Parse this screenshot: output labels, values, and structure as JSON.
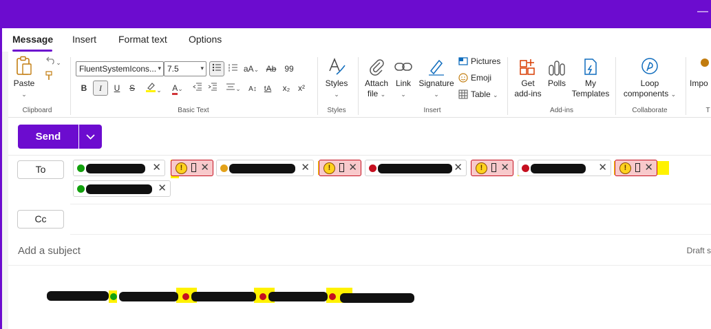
{
  "window": {
    "minimize_glyph": "—"
  },
  "tabs": [
    {
      "label": "Message",
      "active": true
    },
    {
      "label": "Insert",
      "active": false
    },
    {
      "label": "Format text",
      "active": false
    },
    {
      "label": "Options",
      "active": false
    }
  ],
  "ribbon": {
    "clipboard": {
      "paste_label": "Paste",
      "group_label": "Clipboard"
    },
    "basic_text": {
      "font_name": "FluentSystemIcons...",
      "font_size": "7.5",
      "bold": "B",
      "italic": "I",
      "underline": "U",
      "strike": "S",
      "subscript": "x₂",
      "superscript": "x²",
      "group_label": "Basic Text"
    },
    "styles": {
      "label": "Styles",
      "group_label": "Styles"
    },
    "insert": {
      "attach_label": "Attach",
      "attach_label2": "file",
      "link_label": "Link",
      "signature_label": "Signature",
      "pictures_label": "Pictures",
      "emoji_label": "Emoji",
      "table_label": "Table",
      "group_label": "Insert"
    },
    "addins": {
      "get_label": "Get",
      "get_label2": "add-ins",
      "polls_label": "Polls",
      "templates_label": "My",
      "templates_label2": "Templates",
      "group_label": "Add-ins"
    },
    "collaborate": {
      "loop_label": "Loop",
      "loop_label2": "components",
      "group_label": "Collaborate"
    },
    "cut_off": {
      "import_label": "Impo",
      "group_label": "T"
    }
  },
  "send": {
    "label": "Send"
  },
  "compose": {
    "to_label": "To",
    "cc_label": "Cc",
    "subject_placeholder": "Add a subject",
    "draft_label": "Draft s",
    "warn_glyph": "!"
  },
  "colors": {
    "accent": "#6c0ccf",
    "presence_available": "#13a10e",
    "presence_away": "#e3a21a",
    "presence_busy": "#c50f1f",
    "highlight": "#fff200"
  }
}
